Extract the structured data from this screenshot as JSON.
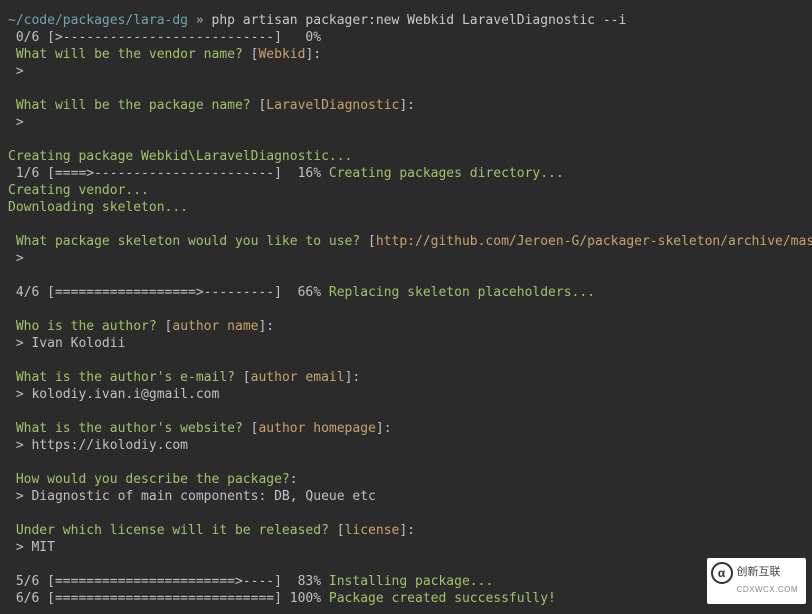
{
  "prompt": {
    "path": "~/code/packages/lara-dg",
    "sep": " » ",
    "cmd": "php artisan packager:new Webkid LaravelDiagnostic --i"
  },
  "l01": {
    "bar": " 0/6 [>---------------------------]   0%"
  },
  "l02": {
    "q": " What will be the vendor name?",
    "open": " [",
    "def": "Webkid",
    "close": "]:"
  },
  "l03": {
    "txt": " >"
  },
  "blank1": " ",
  "l04": {
    "q": " What will be the package name?",
    "open": " [",
    "def": "LaravelDiagnostic",
    "close": "]:"
  },
  "l05": {
    "txt": " >"
  },
  "blank2": " ",
  "l06": {
    "txt": "Creating package Webkid\\LaravelDiagnostic..."
  },
  "l07": {
    "bar": " 1/6 [====>-----------------------]  16% ",
    "msg": "Creating packages directory..."
  },
  "l08": {
    "txt": "Creating vendor..."
  },
  "l09": {
    "txt": "Downloading skeleton..."
  },
  "blank3": " ",
  "l10": {
    "q": " What package skeleton would you like to use?",
    "open": " [",
    "def": "http://github.com/Jeroen-G/packager-skeleton/archive/master.zip",
    "close": "]:"
  },
  "l11": {
    "txt": " >"
  },
  "blank4": " ",
  "l12": {
    "bar": " 4/6 [==================>---------]  66% ",
    "msg": "Replacing skeleton placeholders..."
  },
  "blank5": " ",
  "l13": {
    "q": " Who is the author?",
    "open": " [",
    "def": "author name",
    "close": "]:"
  },
  "l14": {
    "txt": " > Ivan Kolodii"
  },
  "blank6": " ",
  "l15": {
    "q": " What is the author's e-mail?",
    "open": " [",
    "def": "author email",
    "close": "]:"
  },
  "l16": {
    "txt": " > kolodiy.ivan.i@gmail.com"
  },
  "blank7": " ",
  "l17": {
    "q": " What is the author's website?",
    "open": " [",
    "def": "author homepage",
    "close": "]:"
  },
  "l18": {
    "txt": " > https://ikolodiy.com"
  },
  "blank8": " ",
  "l19": {
    "q": " How would you describe the package?",
    "close": ":"
  },
  "l20": {
    "txt": " > Diagnostic of main components: DB, Queue etc"
  },
  "blank9": " ",
  "l21": {
    "q": " Under which license will it be released?",
    "open": " [",
    "def": "license",
    "close": "]:"
  },
  "l22": {
    "txt": " > MIT"
  },
  "blank10": " ",
  "l23": {
    "bar": " 5/6 [=======================>----]  83% ",
    "msg": "Installing package..."
  },
  "l24": {
    "bar": " 6/6 [============================] 100% ",
    "msg": "Package created successfully!"
  },
  "watermark": {
    "main": "创新互联",
    "sub": "CDXWCX.COM",
    "logo": "α"
  }
}
